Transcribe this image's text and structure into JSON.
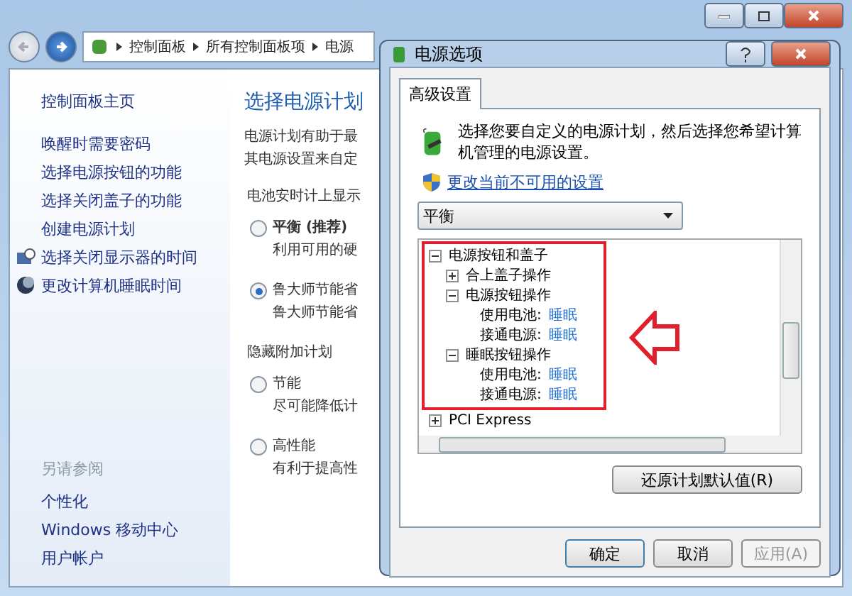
{
  "window": {
    "breadcrumb": [
      "控制面板",
      "所有控制面板项",
      "电源"
    ]
  },
  "sidebar": {
    "items": [
      {
        "label": "控制面板主页",
        "kind": "home"
      },
      {
        "label": "唤醒时需要密码",
        "kind": "link"
      },
      {
        "label": "选择电源按钮的功能",
        "kind": "link"
      },
      {
        "label": "选择关闭盖子的功能",
        "kind": "link"
      },
      {
        "label": "创建电源计划",
        "kind": "link"
      },
      {
        "label": "选择关闭显示器的时间",
        "kind": "monitor"
      },
      {
        "label": "更改计算机睡眠时间",
        "kind": "moon"
      }
    ],
    "see_also": {
      "title": "另请参阅",
      "items": [
        "个性化",
        "Windows 移动中心",
        "用户帐户"
      ]
    }
  },
  "main": {
    "title": "选择电源计划",
    "intro": [
      "电源计划有助于最",
      "其电源设置来自定"
    ],
    "section_label": "电池安时计上显示",
    "plans": [
      {
        "name": "平衡 (推荐)",
        "description": "利用可用的硬",
        "selected": false
      },
      {
        "name": "鲁大师节能省",
        "description": "鲁大师节能省",
        "selected": true
      }
    ],
    "hidden_label": "隐藏附加计划",
    "hidden_plans": [
      {
        "name": "节能",
        "description": "尽可能降低计",
        "selected": false
      },
      {
        "name": "高性能",
        "description": "有利于提高性",
        "selected": false
      }
    ]
  },
  "dialog": {
    "title": "电源选项",
    "tabs": [
      {
        "label": "高级设置",
        "selected": true
      }
    ],
    "description": "选择您要自定义的电源计划，然后选择您希望计算机管理的电源设置。",
    "link": "更改当前不可用的设置",
    "plan_select": {
      "value": "平衡"
    },
    "tree": [
      {
        "label": "电源按钮和盖子",
        "expanded": true,
        "children": [
          {
            "label": "合上盖子操作",
            "expanded": false
          },
          {
            "label": "电源按钮操作",
            "expanded": true,
            "children": [
              {
                "label": "使用电池:",
                "value": "睡眠"
              },
              {
                "label": "接通电源:",
                "value": "睡眠"
              }
            ]
          },
          {
            "label": "睡眠按钮操作",
            "expanded": true,
            "children": [
              {
                "label": "使用电池:",
                "value": "睡眠"
              },
              {
                "label": "接通电源:",
                "value": "睡眠"
              }
            ]
          }
        ]
      },
      {
        "label": "PCI Express",
        "expanded": false
      }
    ],
    "restore_button": "还原计划默认值(R)",
    "buttons": [
      {
        "label": "确定",
        "disabled": false,
        "default": true
      },
      {
        "label": "取消",
        "disabled": false,
        "default": false
      },
      {
        "label": "应用(A)",
        "disabled": true,
        "default": false
      }
    ]
  }
}
